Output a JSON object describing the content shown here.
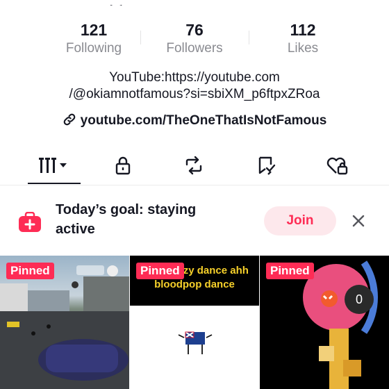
{
  "stats": [
    {
      "value": "121",
      "label": "Following"
    },
    {
      "value": "76",
      "label": "Followers"
    },
    {
      "value": "112",
      "label": "Likes"
    }
  ],
  "bio": {
    "line1": "YouTube:https://youtube.com",
    "line2": "/@okiamnotfamous?si=sbiXM_p6ftpxZRoa"
  },
  "link": {
    "text": "youtube.com/TheOneThatIsNotFamous",
    "icon": "link-icon"
  },
  "tabs": [
    {
      "icon": "videos-grid-icon",
      "active": true
    },
    {
      "icon": "lock-icon"
    },
    {
      "icon": "repost-icon"
    },
    {
      "icon": "favorites-icon"
    },
    {
      "icon": "liked-icon"
    }
  ],
  "goal": {
    "text": "Today’s goal: staying active",
    "join_label": "Join",
    "icon": "goal-bag-icon",
    "close_icon": "close-icon"
  },
  "videos": [
    {
      "pinned_label": "Pinned"
    },
    {
      "pinned_label": "Pinned",
      "caption": "ing a crazy dance ahh bloodpop dance"
    },
    {
      "pinned_label": "Pinned",
      "counter": "0"
    }
  ],
  "colors": {
    "accent": "#fe2c55",
    "join_bg": "#fde8ec",
    "text": "#161823",
    "muted": "#8a8b91"
  }
}
